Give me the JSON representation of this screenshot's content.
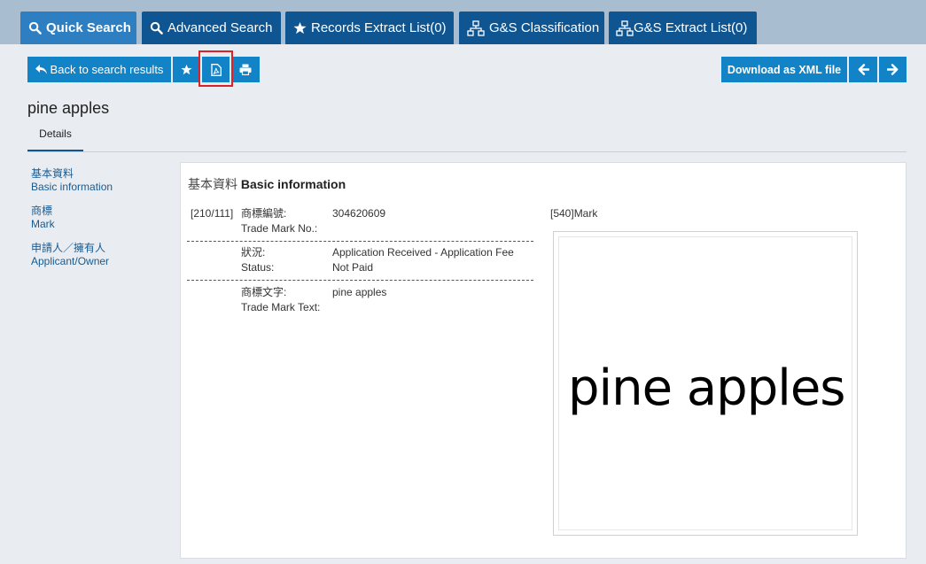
{
  "tabs": {
    "quick_search": "Quick Search",
    "advanced_search": "Advanced Search",
    "records_extract": "Records Extract List(0)",
    "gs_classification": "G&S Classification",
    "gs_extract": "G&S Extract List(0)"
  },
  "toolbar": {
    "back_label": "Back to search results",
    "download_xml": "Download as XML file"
  },
  "page": {
    "title": "pine apples",
    "details_tab": "Details"
  },
  "sidebar": {
    "items": [
      {
        "zh": "基本資料",
        "en": "Basic information"
      },
      {
        "zh": "商標",
        "en": "Mark"
      },
      {
        "zh": "申請人／擁有人",
        "en": "Applicant/Owner"
      }
    ]
  },
  "basic_info": {
    "title_zh": "基本資料",
    "title_en": "Basic information",
    "rows": [
      {
        "code": "[210/111]",
        "label_zh": "商標編號:",
        "label_en": "Trade Mark No.:",
        "value": "304620609"
      },
      {
        "code": "",
        "label_zh": "狀況:",
        "label_en": "Status:",
        "value": "Application Received - Application Fee Not Paid"
      },
      {
        "code": "",
        "label_zh": "商標文字:",
        "label_en": "Trade Mark Text:",
        "value": "pine apples"
      }
    ]
  },
  "mark": {
    "label": "[540]Mark",
    "image_text": "pine apples"
  },
  "colors": {
    "tab_dark": "#0f5592",
    "tab_active": "#2e7fc2",
    "button": "#1283c6",
    "highlight": "#d9232a"
  }
}
